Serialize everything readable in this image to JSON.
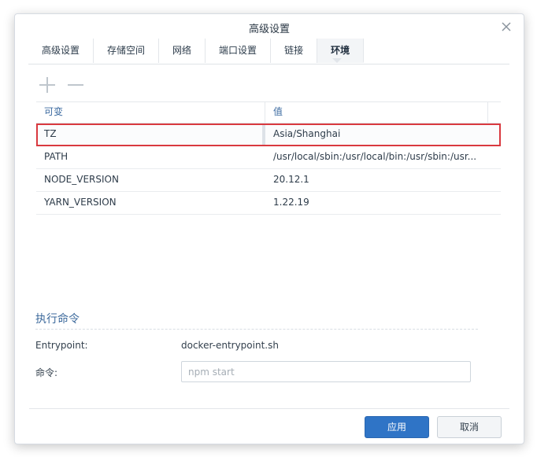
{
  "dialog": {
    "title": "高级设置",
    "close_icon": "close-icon"
  },
  "tabs": [
    {
      "label": "高级设置",
      "active": false
    },
    {
      "label": "存储空间",
      "active": false
    },
    {
      "label": "网络",
      "active": false
    },
    {
      "label": "端口设置",
      "active": false
    },
    {
      "label": "链接",
      "active": false
    },
    {
      "label": "环境",
      "active": true
    }
  ],
  "toolbar": {
    "add_icon": "plus-icon",
    "remove_icon": "minus-icon"
  },
  "env_table": {
    "headers": {
      "variable": "可变",
      "value": "值"
    },
    "rows": [
      {
        "variable": "TZ",
        "value": "Asia/Shanghai",
        "selected": true
      },
      {
        "variable": "PATH",
        "value": "/usr/local/sbin:/usr/local/bin:/usr/sbin:/usr...",
        "selected": false
      },
      {
        "variable": "NODE_VERSION",
        "value": "20.12.1",
        "selected": false
      },
      {
        "variable": "YARN_VERSION",
        "value": "1.22.19",
        "selected": false
      }
    ]
  },
  "execution": {
    "section_title": "执行命令",
    "entrypoint_label": "Entrypoint:",
    "entrypoint_value": "docker-entrypoint.sh",
    "command_label": "命令:",
    "command_value": "",
    "command_placeholder": "npm start"
  },
  "footer": {
    "apply_label": "应用",
    "cancel_label": "取消"
  },
  "colors": {
    "accent": "#2f74c6",
    "selection_border": "#d9393f",
    "header_text": "#3b6aa0"
  }
}
